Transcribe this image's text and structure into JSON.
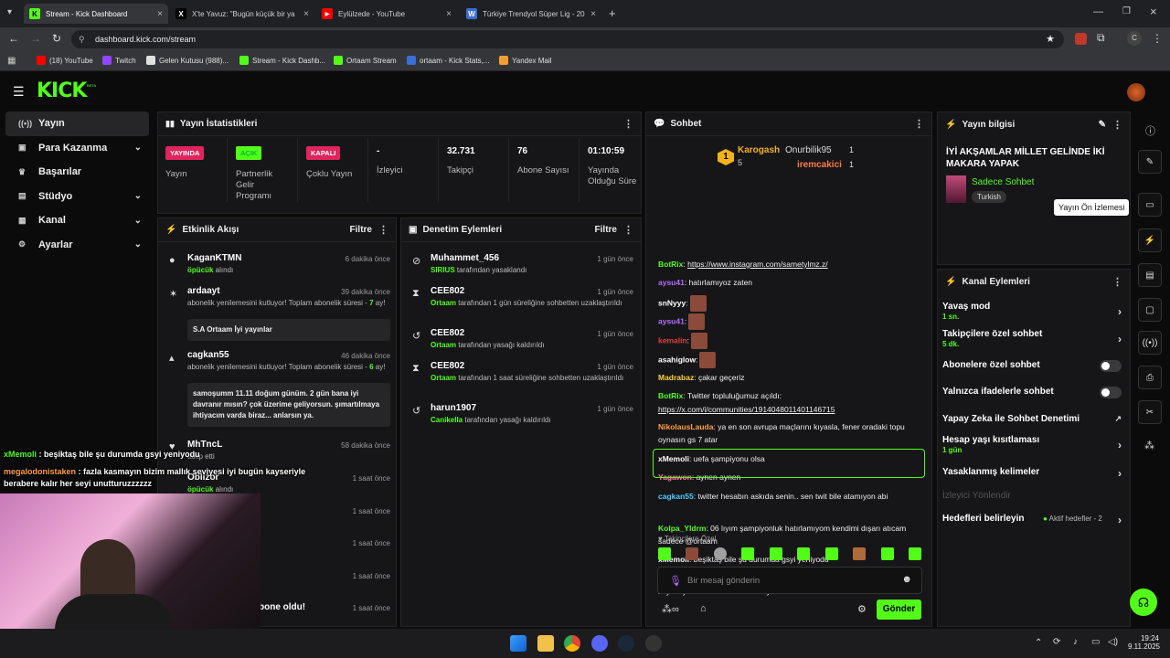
{
  "browser": {
    "tabs": [
      {
        "label": "Stream - Kick Dashboard",
        "active": true
      },
      {
        "label": "X'te Yavuz: \"Bugün küçük bir ya"
      },
      {
        "label": "Eylülzede - YouTube"
      },
      {
        "label": "Türkiye Trendyol Süper Lig - 20"
      }
    ],
    "url": "dashboard.kick.com/stream",
    "profile": "C",
    "bookmarks": [
      "(18) YouTube",
      "Twitch",
      "Gelen Kutusu (988)...",
      "Stream - Kick Dashb...",
      "Ortaam Stream",
      "ortaam - Kick Stats,...",
      "Yandex Mail"
    ]
  },
  "brand": {
    "logo": "KICK",
    "beta": "BETA"
  },
  "sidebar": {
    "items": [
      {
        "label": "Yayın",
        "icon": "((•))"
      },
      {
        "label": "Para Kazanma",
        "icon": "▣"
      },
      {
        "label": "Başarılar",
        "icon": "♛"
      },
      {
        "label": "Stüdyo",
        "icon": "▤"
      },
      {
        "label": "Kanal",
        "icon": "▦"
      },
      {
        "label": "Ayarlar",
        "icon": "⚙"
      }
    ]
  },
  "stats": {
    "title": "Yayın İstatistikleri",
    "cells": [
      {
        "badge": "YAYINDA",
        "label": "Yayın",
        "badge_color": "#e0245e"
      },
      {
        "badge": "AÇIK",
        "label": "Partnerlik Gelir Programı",
        "badge_color": "#53fc18"
      },
      {
        "badge": "KAPALI",
        "label": "Çoklu Yayın",
        "badge_color": "#e0245e"
      },
      {
        "value": "-",
        "label": "İzleyici"
      },
      {
        "value": "32.731",
        "label": "Takipçi"
      },
      {
        "value": "76",
        "label": "Abone Sayısı"
      },
      {
        "value": "01:10:59",
        "label": "Yayında Olduğu Süre"
      }
    ]
  },
  "activity": {
    "title": "Etkinlik Akışı",
    "filter": "Filtre",
    "events": [
      {
        "name": "KaganKTMN",
        "time": "6 dakika önce",
        "hl": "öpücük",
        "rest": " alındı"
      },
      {
        "name": "ardaayt",
        "time": "39 dakika önce",
        "desc": "abonelik yenilemesini kutluyor! Toplam abonelik süresi - ",
        "num": "7",
        "tail": " ay!",
        "msg": "S.A Ortaam İyi yayınlar"
      },
      {
        "name": "cagkan55",
        "time": "46 dakika önce",
        "desc": "abonelik yenilemesini kutluyor! Toplam abonelik süresi - ",
        "num": "6",
        "tail": " ay!",
        "msg": "samoşumm 11.11 doğum günüm. 2 gün bana iyi davranır mısın? çok üzerime geliyorsun. şımartılmaya ihtiyacım varda biraz... anlarsın ya."
      },
      {
        "name": "MhTncL",
        "time": "58 dakika önce",
        "desc": "takip etti"
      },
      {
        "name": "Oblizor",
        "time": "1 saat önce",
        "hl": "öpücük",
        "rest": " alındı"
      },
      {
        "time": "1 saat önce"
      },
      {
        "time": "1 saat önce"
      },
      {
        "time": "1 saat önce"
      },
      {
        "name": "bone oldu!",
        "time": "1 saat önce"
      }
    ]
  },
  "moderation": {
    "title": "Denetim Eylemleri",
    "filter": "Filtre",
    "actions": [
      {
        "name": "Muhammet_456",
        "time": "1 gün önce",
        "actor": "SIRIUS",
        "text": " tarafından yasaklandı"
      },
      {
        "name": "CEE802",
        "time": "1 gün önce",
        "actor": "Ortaam",
        "text": " tarafından 1 gün süreliğine sohbetten uzaklaştırıldı"
      },
      {
        "name": "CEE802",
        "time": "1 gün önce",
        "actor": "Ortaam",
        "text": " tarafından yasağı kaldırıldı"
      },
      {
        "name": "CEE802",
        "time": "1 gün önce",
        "actor": "Ortaam",
        "text": " tarafından 1 saat süreliğine sohbetten uzaklaştırıldı"
      },
      {
        "name": "harun1907",
        "time": "1 gün önce",
        "actor": "Canikella",
        "text": " tarafından yasağı kaldırıldı"
      }
    ]
  },
  "chat": {
    "title": "Sohbet",
    "top": [
      {
        "name": "Karogash",
        "count": "5",
        "rank": "1"
      },
      {
        "name": "Onurbilik95",
        "count": "1"
      },
      {
        "name": "iremcakici",
        "count": "1"
      }
    ],
    "messages": [
      {
        "user": "BotRix",
        "color": "#53fc18",
        "sep": ": ",
        "text": "https://www.instagram.com/sametylmz.z/"
      },
      {
        "user": "aysu41",
        "color": "#b26bff",
        "sep": ": ",
        "text": "hatırlamıyoz zaten"
      },
      {
        "user": "snNyyy",
        "color": "#ffffff",
        "sep": ":",
        "text": ""
      },
      {
        "user": "aysu41",
        "color": "#b26bff",
        "sep": ":",
        "text": ""
      },
      {
        "user": "kemalin",
        "color": "#e03c3c",
        "sep": ":",
        "text": ""
      },
      {
        "user": "asahiglow",
        "color": "#ffffff",
        "sep": ":",
        "text": ""
      },
      {
        "user": "Madrabaz",
        "color": "#ffd23c",
        "sep": ": ",
        "text": "çakar geçeriz"
      },
      {
        "user": "BotRix",
        "color": "#53fc18",
        "sep": ": ",
        "text": "Twitter topluluğumuz açıldı:"
      },
      {
        "user": "",
        "color": "#fff",
        "sep": "",
        "text": "https://x.com/i/communities/1914048011401146715"
      },
      {
        "user": "NikolausLauda",
        "color": "#ff9f3c",
        "sep": ": ",
        "text": "ya en son avrupa maçlarını kıyasla, fener oradaki topu oynasın gs 7 atar"
      },
      {
        "user": "xMemoli",
        "color": "#ffffff",
        "sep": ": ",
        "text": "uefa şampiyonu olsa"
      },
      {
        "user": "Yagawon",
        "color": "#ff7aa8",
        "sep": ": ",
        "text": "aynen aynen"
      },
      {
        "user": "cagkan55",
        "color": "#4cc9ff",
        "sep": ": ",
        "text": "twitter hesabın askıda senin.. sen twit bile atamıyon abi"
      },
      {
        "user": "Kolpa_Yldrm",
        "color": "#53fc18",
        "sep": ": ",
        "text": "06 lıyım şampiyonluk hatırlamıyom kendimi dışarı atıcam sadece @ortaam"
      },
      {
        "user": "xMemoli",
        "color": "#ffffff",
        "sep": ": ",
        "text": "beşiktaş bile şu durumda gsyi yeniyodu"
      },
      {
        "user": "megalodonistaken",
        "color": "#ff9f3c",
        "sep": ": ",
        "text": "fazla kasmayın bizim mallık seviyesi iyi bugün kayseriyle berabere kalır her seyi unutturuzzzzzz"
      }
    ],
    "followers_only": "Takipçilere Özel",
    "placeholder": "Bir mesaj gönderin",
    "send": "Gönder"
  },
  "info": {
    "title": "Yayın bilgisi",
    "stream_title": "İYİ AKŞAMLAR MİLLET GELİNDE İKİ MAKARA YAPAK",
    "category": "Sadece Sohbet",
    "tag": "Turkish"
  },
  "channel": {
    "title": "Kanal Eylemleri",
    "items": [
      {
        "label": "Yavaş mod",
        "sub": "1 sn.",
        "kind": "arrow"
      },
      {
        "label": "Takipçilere özel sohbet",
        "sub": "5 dk.",
        "kind": "arrow"
      },
      {
        "label": "Abonelere özel sohbet",
        "kind": "toggle"
      },
      {
        "label": "Yalnızca ifadelerle sohbet",
        "kind": "toggle"
      },
      {
        "label": "Yapay Zeka ile Sohbet Denetimi",
        "kind": "ext"
      },
      {
        "label": "Hesap yaşı kısıtlaması",
        "sub": "1 gün",
        "kind": "arrow"
      },
      {
        "label": "Yasaklanmış kelimeler",
        "kind": "arrow"
      },
      {
        "label": "İzleyici Yönlendir",
        "kind": "disabled"
      },
      {
        "label": "Hedefleri belirleyin",
        "kind": "goals",
        "extra": "Aktif hedefler - 2"
      }
    ]
  },
  "tooltip": "Yayın Ön İzlemesi",
  "overlay": {
    "lines": [
      {
        "user": "xMemoli",
        "text": " : beşiktaş bile şu durumda gsyi yeniyodu"
      },
      {
        "user": "megalodonistaken",
        "text": " : fazla kasmayın bizim mallık seviyesi iyi bugün kayseriyle berabere kalır her seyi unutturuzzzzzz"
      }
    ]
  },
  "taskbar": {
    "time": "19:24",
    "date": "9.11.2025"
  }
}
